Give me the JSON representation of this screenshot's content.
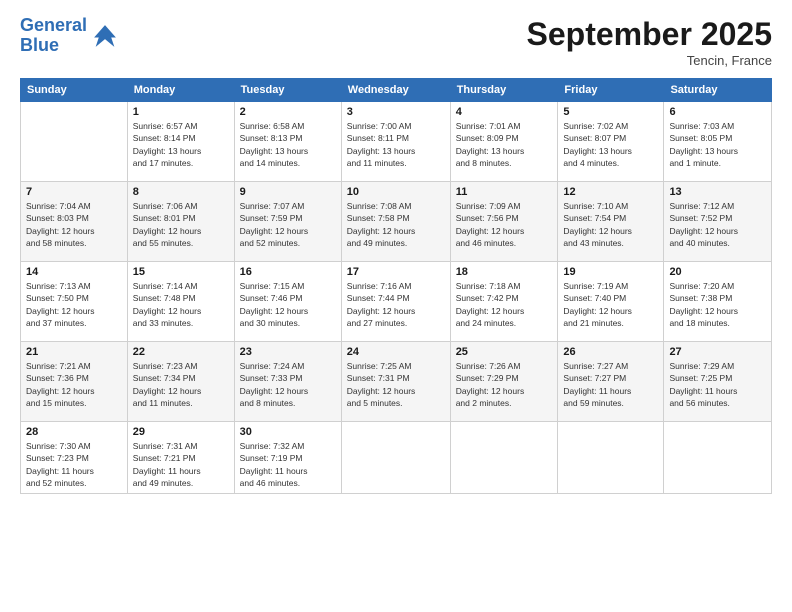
{
  "header": {
    "logo_line1": "General",
    "logo_line2": "Blue",
    "month": "September 2025",
    "location": "Tencin, France"
  },
  "weekdays": [
    "Sunday",
    "Monday",
    "Tuesday",
    "Wednesday",
    "Thursday",
    "Friday",
    "Saturday"
  ],
  "rows": [
    [
      {
        "day": "",
        "info": ""
      },
      {
        "day": "1",
        "info": "Sunrise: 6:57 AM\nSunset: 8:14 PM\nDaylight: 13 hours\nand 17 minutes."
      },
      {
        "day": "2",
        "info": "Sunrise: 6:58 AM\nSunset: 8:13 PM\nDaylight: 13 hours\nand 14 minutes."
      },
      {
        "day": "3",
        "info": "Sunrise: 7:00 AM\nSunset: 8:11 PM\nDaylight: 13 hours\nand 11 minutes."
      },
      {
        "day": "4",
        "info": "Sunrise: 7:01 AM\nSunset: 8:09 PM\nDaylight: 13 hours\nand 8 minutes."
      },
      {
        "day": "5",
        "info": "Sunrise: 7:02 AM\nSunset: 8:07 PM\nDaylight: 13 hours\nand 4 minutes."
      },
      {
        "day": "6",
        "info": "Sunrise: 7:03 AM\nSunset: 8:05 PM\nDaylight: 13 hours\nand 1 minute."
      }
    ],
    [
      {
        "day": "7",
        "info": "Sunrise: 7:04 AM\nSunset: 8:03 PM\nDaylight: 12 hours\nand 58 minutes."
      },
      {
        "day": "8",
        "info": "Sunrise: 7:06 AM\nSunset: 8:01 PM\nDaylight: 12 hours\nand 55 minutes."
      },
      {
        "day": "9",
        "info": "Sunrise: 7:07 AM\nSunset: 7:59 PM\nDaylight: 12 hours\nand 52 minutes."
      },
      {
        "day": "10",
        "info": "Sunrise: 7:08 AM\nSunset: 7:58 PM\nDaylight: 12 hours\nand 49 minutes."
      },
      {
        "day": "11",
        "info": "Sunrise: 7:09 AM\nSunset: 7:56 PM\nDaylight: 12 hours\nand 46 minutes."
      },
      {
        "day": "12",
        "info": "Sunrise: 7:10 AM\nSunset: 7:54 PM\nDaylight: 12 hours\nand 43 minutes."
      },
      {
        "day": "13",
        "info": "Sunrise: 7:12 AM\nSunset: 7:52 PM\nDaylight: 12 hours\nand 40 minutes."
      }
    ],
    [
      {
        "day": "14",
        "info": "Sunrise: 7:13 AM\nSunset: 7:50 PM\nDaylight: 12 hours\nand 37 minutes."
      },
      {
        "day": "15",
        "info": "Sunrise: 7:14 AM\nSunset: 7:48 PM\nDaylight: 12 hours\nand 33 minutes."
      },
      {
        "day": "16",
        "info": "Sunrise: 7:15 AM\nSunset: 7:46 PM\nDaylight: 12 hours\nand 30 minutes."
      },
      {
        "day": "17",
        "info": "Sunrise: 7:16 AM\nSunset: 7:44 PM\nDaylight: 12 hours\nand 27 minutes."
      },
      {
        "day": "18",
        "info": "Sunrise: 7:18 AM\nSunset: 7:42 PM\nDaylight: 12 hours\nand 24 minutes."
      },
      {
        "day": "19",
        "info": "Sunrise: 7:19 AM\nSunset: 7:40 PM\nDaylight: 12 hours\nand 21 minutes."
      },
      {
        "day": "20",
        "info": "Sunrise: 7:20 AM\nSunset: 7:38 PM\nDaylight: 12 hours\nand 18 minutes."
      }
    ],
    [
      {
        "day": "21",
        "info": "Sunrise: 7:21 AM\nSunset: 7:36 PM\nDaylight: 12 hours\nand 15 minutes."
      },
      {
        "day": "22",
        "info": "Sunrise: 7:23 AM\nSunset: 7:34 PM\nDaylight: 12 hours\nand 11 minutes."
      },
      {
        "day": "23",
        "info": "Sunrise: 7:24 AM\nSunset: 7:33 PM\nDaylight: 12 hours\nand 8 minutes."
      },
      {
        "day": "24",
        "info": "Sunrise: 7:25 AM\nSunset: 7:31 PM\nDaylight: 12 hours\nand 5 minutes."
      },
      {
        "day": "25",
        "info": "Sunrise: 7:26 AM\nSunset: 7:29 PM\nDaylight: 12 hours\nand 2 minutes."
      },
      {
        "day": "26",
        "info": "Sunrise: 7:27 AM\nSunset: 7:27 PM\nDaylight: 11 hours\nand 59 minutes."
      },
      {
        "day": "27",
        "info": "Sunrise: 7:29 AM\nSunset: 7:25 PM\nDaylight: 11 hours\nand 56 minutes."
      }
    ],
    [
      {
        "day": "28",
        "info": "Sunrise: 7:30 AM\nSunset: 7:23 PM\nDaylight: 11 hours\nand 52 minutes."
      },
      {
        "day": "29",
        "info": "Sunrise: 7:31 AM\nSunset: 7:21 PM\nDaylight: 11 hours\nand 49 minutes."
      },
      {
        "day": "30",
        "info": "Sunrise: 7:32 AM\nSunset: 7:19 PM\nDaylight: 11 hours\nand 46 minutes."
      },
      {
        "day": "",
        "info": ""
      },
      {
        "day": "",
        "info": ""
      },
      {
        "day": "",
        "info": ""
      },
      {
        "day": "",
        "info": ""
      }
    ]
  ]
}
